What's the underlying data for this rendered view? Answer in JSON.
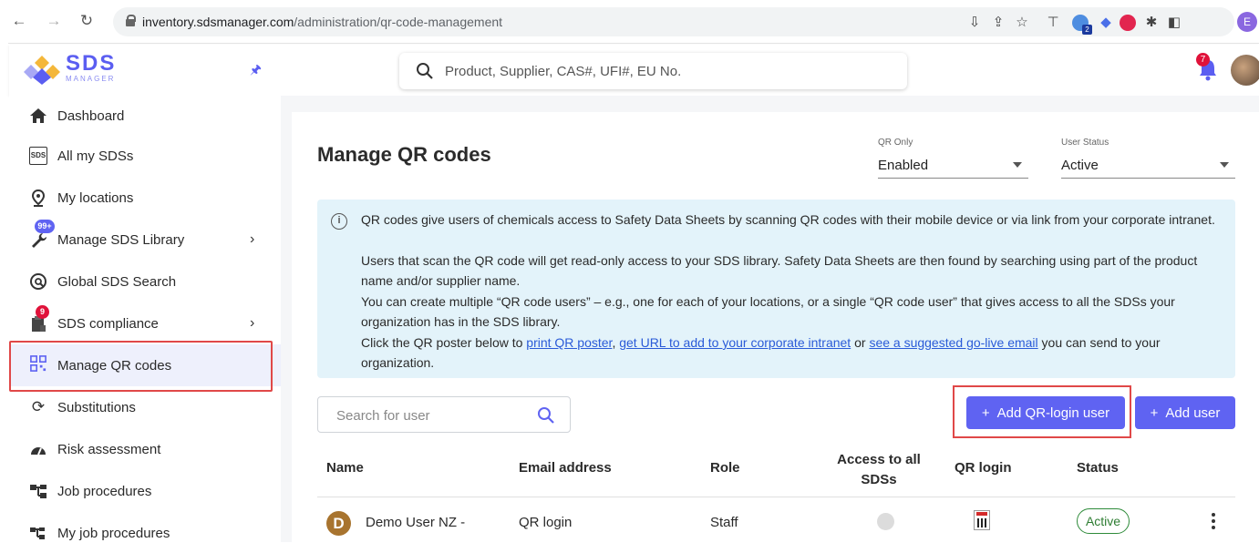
{
  "browser": {
    "url_domain": "inventory.sdsmanager.com",
    "url_path": "/administration/qr-code-management",
    "profile_initial": "E",
    "extension_badge": "2"
  },
  "header": {
    "brand": "SDS",
    "brand_sub": "MANAGER",
    "search_placeholder": "Product, Supplier, CAS#, UFI#, EU No.",
    "notification_count": "7"
  },
  "sidebar": {
    "items": [
      {
        "label": "Dashboard"
      },
      {
        "label": "All my SDSs"
      },
      {
        "label": "My locations"
      },
      {
        "label": "Manage SDS Library",
        "badge": "99+"
      },
      {
        "label": "Global SDS Search"
      },
      {
        "label": "SDS compliance",
        "badge": "9"
      },
      {
        "label": "Manage QR codes"
      },
      {
        "label": "Substitutions"
      },
      {
        "label": "Risk assessment"
      },
      {
        "label": "Job procedures"
      },
      {
        "label": "My job procedures"
      }
    ],
    "sds_icon_text": "SDS"
  },
  "page": {
    "title": "Manage QR codes",
    "filters": {
      "qr_only": {
        "label": "QR Only",
        "value": "Enabled"
      },
      "user_status": {
        "label": "User Status",
        "value": "Active"
      }
    },
    "info": {
      "p1": "QR codes give users of chemicals access to Safety Data Sheets by scanning QR codes with their mobile device or via link from your corporate intranet.",
      "p2": "Users that scan the QR code will get read-only access to your SDS library. Safety Data Sheets are then found by searching using part of the product name and/or supplier name.",
      "p3": "You can create multiple “QR code users” – e.g., one for each of your locations, or a single “QR code user” that gives access to all the SDSs your organization has in the SDS library.",
      "p4_start": "Click the QR poster below to ",
      "link1": "print QR poster",
      "sep1": ", ",
      "link2": "get URL to add to your corporate intranet",
      "sep2": " or ",
      "link3": "see a suggested go-live email",
      "p4_end": " you can send to your organization."
    },
    "user_search_placeholder": "Search for user",
    "buttons": {
      "add_qr_login_user": "Add QR-login user",
      "add_user": "Add user"
    },
    "table": {
      "columns": [
        "Name",
        "Email address",
        "Role",
        "Access to all SDSs",
        "QR login",
        "Status"
      ],
      "rows": [
        {
          "avatar": "D",
          "name": "Demo User NZ -",
          "email": "QR login",
          "role": "Staff",
          "status": "Active"
        }
      ]
    }
  }
}
